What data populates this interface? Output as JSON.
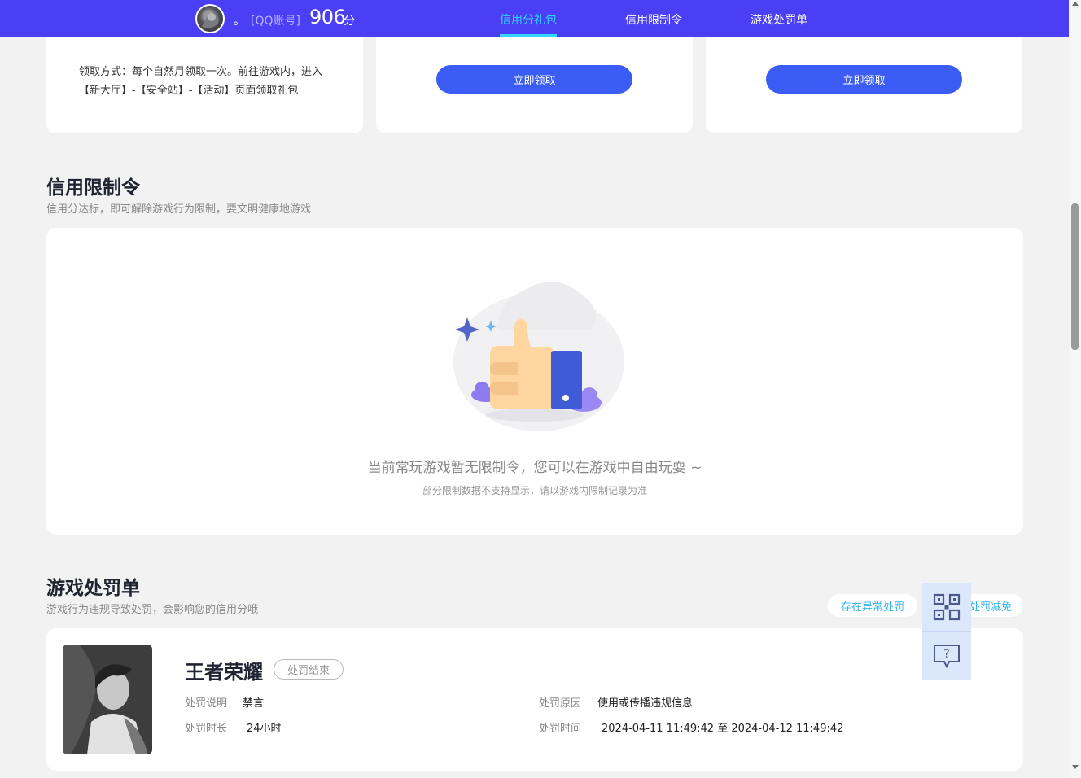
{
  "header": {
    "nickname": "。",
    "account_type": "[QQ账号]",
    "score": "906",
    "score_unit": "分",
    "tabs": [
      {
        "label": "信用分礼包",
        "active": true
      },
      {
        "label": "信用限制令",
        "active": false
      },
      {
        "label": "游戏处罚单",
        "active": false
      }
    ]
  },
  "gift_cards": {
    "card1_method": "领取方式：每个自然月领取一次。前往游戏内，进入【新大厅】-【安全站】-【活动】页面领取礼包",
    "card2_button": "立即领取",
    "card3_button": "立即领取"
  },
  "restriction": {
    "title": "信用限制令",
    "subtitle": "信用分达标，即可解除游戏行为限制，要文明健康地游戏",
    "empty_main": "当前常玩游戏暂无限制令，您可以在游戏中自由玩耍 ~",
    "empty_sub": "部分限制数据不支持显示，请以游戏内限制记录为准"
  },
  "penalty": {
    "title": "游戏处罚单",
    "subtitle": "游戏行为违规导致处罚，会影响您的信用分哦",
    "pill_abnormal": "存在异常处罚",
    "pill_reduce": "处罚减免",
    "item": {
      "game": "王者荣耀",
      "status": "处罚结束",
      "desc_label": "处罚说明",
      "desc_value": "禁言",
      "duration_label": "处罚时长",
      "duration_value": "24小时",
      "reason_label": "处罚原因",
      "reason_value": "使用或传播违规信息",
      "time_label": "处罚时间",
      "time_value": "2024-04-11 11:49:42 至 2024-04-12 11:49:42"
    }
  },
  "float_tools": {
    "qr_icon": "qrcode-icon",
    "help_icon": "question-chat-icon",
    "icon_color": "#4a5a8a"
  },
  "colors": {
    "topbar": "#4a3ff5",
    "active_tab": "#35d4ff",
    "button": "#3b5df5",
    "pill_text": "#34b4e8"
  }
}
